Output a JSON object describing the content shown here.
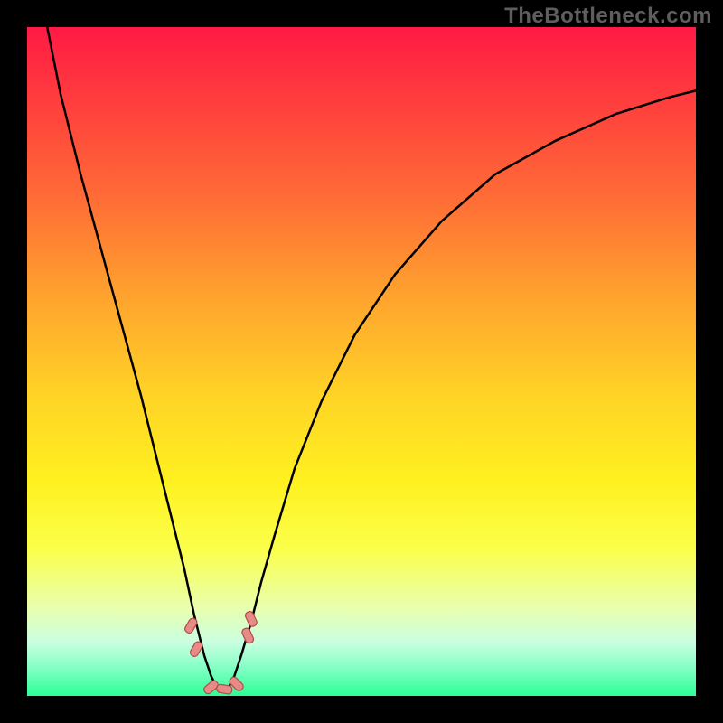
{
  "watermark": "TheBottleneck.com",
  "chart_data": {
    "type": "line",
    "title": "",
    "xlabel": "",
    "ylabel": "",
    "xlim": [
      0,
      100
    ],
    "ylim": [
      0,
      100
    ],
    "x_min_curve": 28,
    "series": [
      {
        "name": "curve",
        "x": [
          3,
          5,
          8,
          11,
          14,
          17,
          19,
          21,
          23.5,
          25,
          26.5,
          27.5,
          28.5,
          30,
          31,
          32,
          33.5,
          35,
          37,
          40,
          44,
          49,
          55,
          62,
          70,
          79,
          88,
          96,
          100
        ],
        "values": [
          100,
          90,
          78,
          67,
          56,
          45,
          37,
          29,
          19,
          12,
          6,
          3,
          1,
          1,
          3,
          6,
          11,
          17,
          24,
          34,
          44,
          54,
          63,
          71,
          78,
          83,
          87,
          89.5,
          90.5
        ]
      }
    ],
    "markers": [
      {
        "name": "m1",
        "x": 24.5,
        "y": 10.5,
        "rotation": -60
      },
      {
        "name": "m2",
        "x": 25.3,
        "y": 7.0,
        "rotation": -60
      },
      {
        "name": "m3",
        "x": 27.5,
        "y": 1.3,
        "rotation": -40
      },
      {
        "name": "m4",
        "x": 29.5,
        "y": 1.0,
        "rotation": 10
      },
      {
        "name": "m5",
        "x": 31.3,
        "y": 1.8,
        "rotation": 45
      },
      {
        "name": "m6",
        "x": 33.0,
        "y": 9.0,
        "rotation": 65
      },
      {
        "name": "m7",
        "x": 33.5,
        "y": 11.5,
        "rotation": 65
      }
    ],
    "marker_style": {
      "fill": "#e88a86",
      "stroke": "#b14d4d",
      "rx": 4,
      "w": 17,
      "h": 9
    },
    "colors": {
      "curve_stroke": "#000000",
      "background_top": "#ff1a44",
      "background_bottom": "#2bff95",
      "frame": "#000000"
    }
  }
}
